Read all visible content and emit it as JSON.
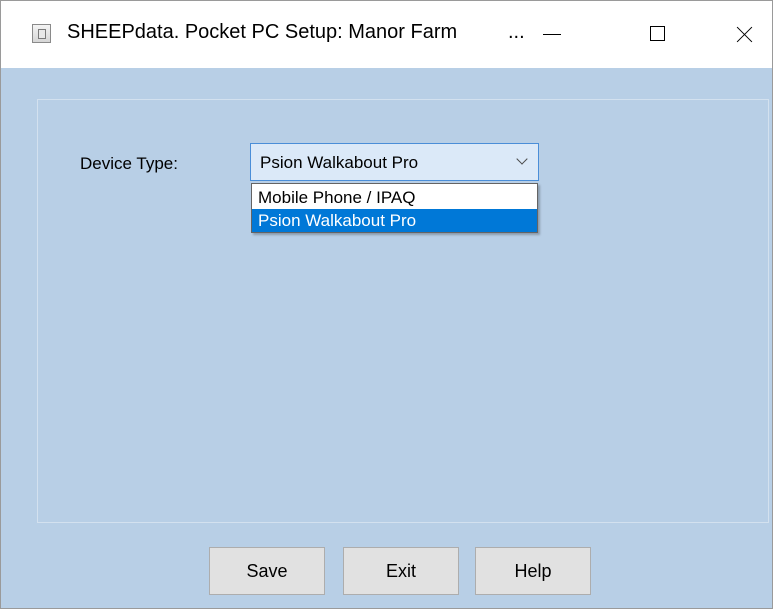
{
  "window": {
    "title": "SHEEPdata. Pocket PC Setup: Manor Farm",
    "title_overflow": "...",
    "controls": {
      "minimize": "minimize-icon",
      "maximize": "maximize-icon",
      "close": "close-icon"
    }
  },
  "form": {
    "device_type_label": "Device Type:",
    "device_type_value": "Psion Walkabout Pro",
    "device_type_options": [
      "Mobile Phone / IPAQ",
      "Psion Walkabout Pro"
    ],
    "selected_index": 1
  },
  "buttons": {
    "save": "Save",
    "exit": "Exit",
    "help": "Help"
  },
  "colors": {
    "window_background": "#b8cfe6",
    "selection": "#0078d7",
    "combo_focus": "#4a8ed8"
  }
}
